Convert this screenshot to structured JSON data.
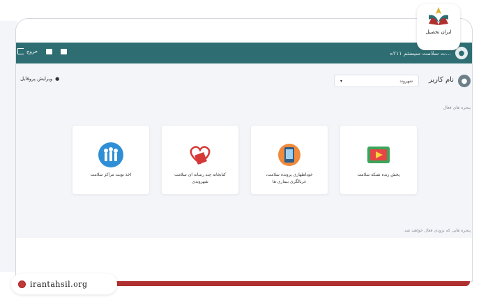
{
  "header": {
    "title": "...ت سلامت سیستم ۲۱۱ه",
    "logout_label": "خروج",
    "icons": [
      "message-icon",
      "mail-icon",
      "logout-icon"
    ]
  },
  "user": {
    "name": "نام کاربر",
    "city_select": "شهروند",
    "edit_profile": "ویرایش پروفایل"
  },
  "section": {
    "label": "پنجره های فعال",
    "footer_note": "پنجره هایی که بزودی فعال خواهند شد"
  },
  "cards": [
    {
      "label": "پخش زنده شبکه سلامت",
      "icon": "tv-icon"
    },
    {
      "label": "خوداظهاری پرونده سلامت، غربالگری بیماری ها",
      "icon": "tablet-icon"
    },
    {
      "label": "کتابخانه چند رسانه ای سلامت شهروندی",
      "icon": "book-heart-icon"
    },
    {
      "label": "اخذ نوبت مراکز سلامت",
      "icon": "people-icon"
    }
  ],
  "brand": {
    "logo_text": "ایران تحصیل",
    "site": "irantahsil.org"
  },
  "colors": {
    "header": "#2e6e72",
    "accent": "#b03030",
    "background": "#f3f5f9"
  }
}
